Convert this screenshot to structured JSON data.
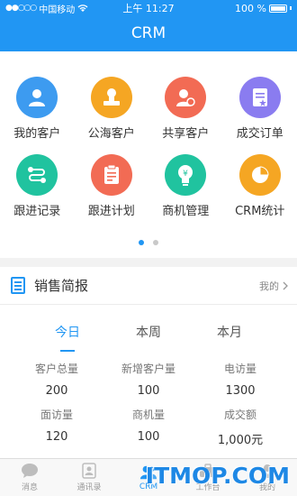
{
  "status_bar": {
    "carrier": "中国移动",
    "time": "上午 11:27",
    "battery": "100 %"
  },
  "header": {
    "title": "CRM"
  },
  "apps": [
    {
      "label": "我的客户",
      "icon": "user-icon",
      "color": "#3d9bf0"
    },
    {
      "label": "公海客户",
      "icon": "stamp-icon",
      "color": "#f5a623"
    },
    {
      "label": "共享客户",
      "icon": "users-share-icon",
      "color": "#f26b54"
    },
    {
      "label": "成交订单",
      "icon": "order-icon",
      "color": "#8a7cf0"
    },
    {
      "label": "跟进记录",
      "icon": "route-icon",
      "color": "#20c39f"
    },
    {
      "label": "跟进计划",
      "icon": "clipboard-icon",
      "color": "#f26b54"
    },
    {
      "label": "商机管理",
      "icon": "bulb-icon",
      "color": "#20c39f"
    },
    {
      "label": "CRM统计",
      "icon": "pie-chart-icon",
      "color": "#f5a623"
    }
  ],
  "brief": {
    "title": "销售简报",
    "link": "我的",
    "tabs": [
      "今日",
      "本周",
      "本月"
    ],
    "active_tab": 0,
    "stats": [
      {
        "label": "客户总量",
        "value": "200"
      },
      {
        "label": "新增客户量",
        "value": "100"
      },
      {
        "label": "电访量",
        "value": "1300"
      },
      {
        "label": "面访量",
        "value": "120"
      },
      {
        "label": "商机量",
        "value": "100"
      },
      {
        "label": "成交额",
        "value": "1,000元"
      }
    ]
  },
  "tabbar": [
    "消息",
    "通讯录",
    "CRM",
    "工作台",
    "我的"
  ],
  "watermark": "ITMOP.COM"
}
